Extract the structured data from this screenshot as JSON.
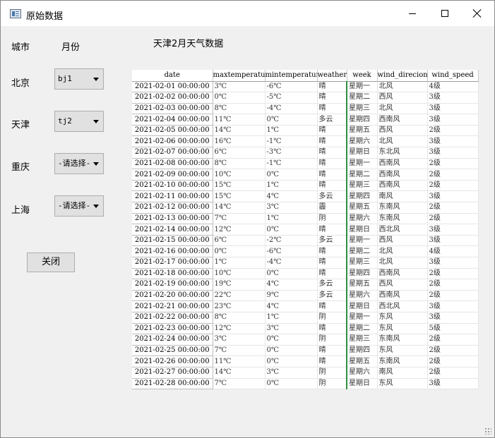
{
  "window": {
    "title": "原始数据"
  },
  "labels": {
    "city": "城市",
    "month": "月份"
  },
  "cities": [
    {
      "name": "北京",
      "selected": "bj1"
    },
    {
      "name": "天津",
      "selected": "tj2"
    },
    {
      "name": "重庆",
      "selected": "-请选择-"
    },
    {
      "name": "上海",
      "selected": "-请选择-"
    }
  ],
  "close_button": "关闭",
  "table": {
    "title": "天津2月天气数据",
    "columns": [
      "date",
      "maxtemperature",
      "mintemperature",
      "weather",
      "week",
      "wind_direcion",
      "wind_speed"
    ],
    "rows": [
      [
        "2021-02-01 00:00:00",
        "3℃",
        "-6℃",
        "晴",
        "星期一",
        "北风",
        "4级"
      ],
      [
        "2021-02-02 00:00:00",
        "0℃",
        "-5℃",
        "晴",
        "星期二",
        "西风",
        "3级"
      ],
      [
        "2021-02-03 00:00:00",
        "8℃",
        "-4℃",
        "晴",
        "星期三",
        "北风",
        "3级"
      ],
      [
        "2021-02-04 00:00:00",
        "11℃",
        "0℃",
        "多云",
        "星期四",
        "西南风",
        "3级"
      ],
      [
        "2021-02-05 00:00:00",
        "14℃",
        "1℃",
        "晴",
        "星期五",
        "西风",
        "2级"
      ],
      [
        "2021-02-06 00:00:00",
        "16℃",
        "-1℃",
        "晴",
        "星期六",
        "北风",
        "3级"
      ],
      [
        "2021-02-07 00:00:00",
        "6℃",
        "-3℃",
        "晴",
        "星期日",
        "东北风",
        "3级"
      ],
      [
        "2021-02-08 00:00:00",
        "8℃",
        "-1℃",
        "晴",
        "星期一",
        "西南风",
        "2级"
      ],
      [
        "2021-02-09 00:00:00",
        "10℃",
        "0℃",
        "晴",
        "星期二",
        "西南风",
        "2级"
      ],
      [
        "2021-02-10 00:00:00",
        "15℃",
        "1℃",
        "晴",
        "星期三",
        "西南风",
        "2级"
      ],
      [
        "2021-02-11 00:00:00",
        "15℃",
        "4℃",
        "多云",
        "星期四",
        "南风",
        "3级"
      ],
      [
        "2021-02-12 00:00:00",
        "14℃",
        "3℃",
        "霾",
        "星期五",
        "东南风",
        "2级"
      ],
      [
        "2021-02-13 00:00:00",
        "7℃",
        "1℃",
        "阴",
        "星期六",
        "东南风",
        "2级"
      ],
      [
        "2021-02-14 00:00:00",
        "12℃",
        "0℃",
        "晴",
        "星期日",
        "西北风",
        "3级"
      ],
      [
        "2021-02-15 00:00:00",
        "6℃",
        "-2℃",
        "多云",
        "星期一",
        "西风",
        "3级"
      ],
      [
        "2021-02-16 00:00:00",
        "0℃",
        "-6℃",
        "晴",
        "星期二",
        "北风",
        "4级"
      ],
      [
        "2021-02-17 00:00:00",
        "1℃",
        "-4℃",
        "晴",
        "星期三",
        "北风",
        "3级"
      ],
      [
        "2021-02-18 00:00:00",
        "10℃",
        "0℃",
        "晴",
        "星期四",
        "西南风",
        "2级"
      ],
      [
        "2021-02-19 00:00:00",
        "19℃",
        "4℃",
        "多云",
        "星期五",
        "西风",
        "2级"
      ],
      [
        "2021-02-20 00:00:00",
        "22℃",
        "9℃",
        "多云",
        "星期六",
        "西南风",
        "2级"
      ],
      [
        "2021-02-21 00:00:00",
        "23℃",
        "4℃",
        "晴",
        "星期日",
        "西北风",
        "3级"
      ],
      [
        "2021-02-22 00:00:00",
        "8℃",
        "1℃",
        "阴",
        "星期一",
        "东风",
        "3级"
      ],
      [
        "2021-02-23 00:00:00",
        "12℃",
        "3℃",
        "晴",
        "星期二",
        "东风",
        "5级"
      ],
      [
        "2021-02-24 00:00:00",
        "3℃",
        "0℃",
        "阴",
        "星期三",
        "东南风",
        "2级"
      ],
      [
        "2021-02-25 00:00:00",
        "7℃",
        "0℃",
        "晴",
        "星期四",
        "东风",
        "2级"
      ],
      [
        "2021-02-26 00:00:00",
        "11℃",
        "0℃",
        "晴",
        "星期五",
        "东南风",
        "2级"
      ],
      [
        "2021-02-27 00:00:00",
        "14℃",
        "3℃",
        "阴",
        "星期六",
        "南风",
        "2级"
      ],
      [
        "2021-02-28 00:00:00",
        "7℃",
        "0℃",
        "阴",
        "星期日",
        "东风",
        "3级"
      ]
    ]
  }
}
